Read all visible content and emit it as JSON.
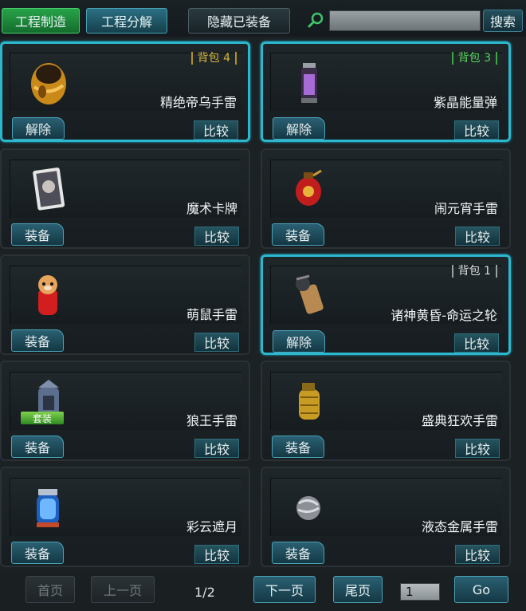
{
  "toolbar": {
    "craft_label": "工程制造",
    "disassemble_label": "工程分解",
    "hide_equipped_label": "隐藏已装备",
    "search_placeholder": "",
    "search_label": "搜索"
  },
  "items": [
    {
      "name": "精绝帝乌手雷",
      "bag": "背包 4",
      "bag_color": "gold",
      "action": "解除",
      "compare": "比较",
      "selected": true,
      "icon": "golden-egg-grenade-icon"
    },
    {
      "name": "紫晶能量弹",
      "bag": "背包 3",
      "bag_color": "green",
      "action": "解除",
      "compare": "比较",
      "selected": true,
      "icon": "purple-canister-grenade-icon"
    },
    {
      "name": "魔术卡牌",
      "bag": "",
      "action": "装备",
      "compare": "比较",
      "selected": false,
      "icon": "magic-card-icon"
    },
    {
      "name": "闹元宵手雷",
      "bag": "",
      "action": "装备",
      "compare": "比较",
      "selected": false,
      "icon": "red-lantern-grenade-icon"
    },
    {
      "name": "萌鼠手雷",
      "bag": "",
      "action": "装备",
      "compare": "比较",
      "selected": false,
      "icon": "hamster-grenade-icon"
    },
    {
      "name": "诸神黄昏-命运之轮",
      "bag": "背包 1",
      "bag_color": "white",
      "action": "解除",
      "compare": "比较",
      "selected": true,
      "icon": "wheel-of-fate-grenade-icon"
    },
    {
      "name": "狼王手雷",
      "bag": "",
      "badge": "套装",
      "action": "装备",
      "compare": "比较",
      "selected": false,
      "icon": "wolf-king-grenade-icon"
    },
    {
      "name": "盛典狂欢手雷",
      "bag": "",
      "action": "装备",
      "compare": "比较",
      "selected": false,
      "icon": "gold-frag-grenade-icon"
    },
    {
      "name": "彩云遮月",
      "bag": "",
      "action": "装备",
      "compare": "比较",
      "selected": false,
      "icon": "blue-capsule-grenade-icon"
    },
    {
      "name": "液态金属手雷",
      "bag": "",
      "action": "装备",
      "compare": "比较",
      "selected": false,
      "icon": "liquid-metal-sphere-icon"
    }
  ],
  "pager": {
    "first": "首页",
    "prev": "上一页",
    "info": "1/2",
    "next": "下一页",
    "last": "尾页",
    "page_input": "1",
    "go": "Go"
  },
  "colors": {
    "accent": "#2bb8cf",
    "green_button": "#27a34a",
    "bag_gold": "#d7b53b",
    "bag_green": "#55d35b"
  }
}
